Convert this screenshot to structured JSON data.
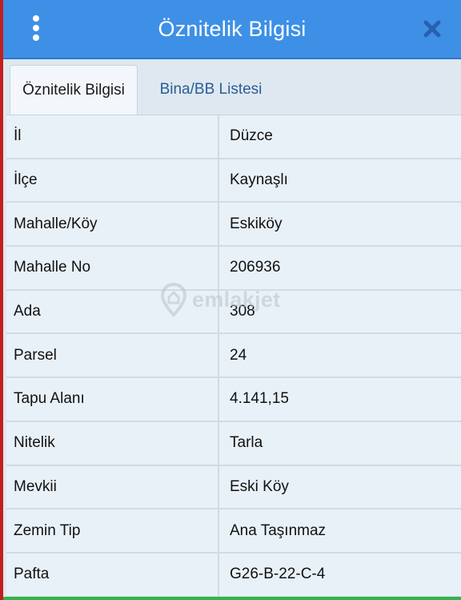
{
  "header": {
    "title": "Öznitelik Bilgisi",
    "menu_icon": "vertical-dots-icon",
    "close_icon": "close-icon"
  },
  "tabs": [
    {
      "label": "Öznitelik Bilgisi",
      "active": true
    },
    {
      "label": "Bina/BB Listesi",
      "active": false
    }
  ],
  "rows": [
    {
      "label": "İl",
      "value": "Düzce"
    },
    {
      "label": "İlçe",
      "value": "Kaynaşlı"
    },
    {
      "label": "Mahalle/Köy",
      "value": "Eskiköy"
    },
    {
      "label": "Mahalle No",
      "value": "206936"
    },
    {
      "label": "Ada",
      "value": "308"
    },
    {
      "label": "Parsel",
      "value": "24"
    },
    {
      "label": "Tapu Alanı",
      "value": "4.141,15"
    },
    {
      "label": "Nitelik",
      "value": "Tarla"
    },
    {
      "label": "Mevkii",
      "value": "Eski Köy"
    },
    {
      "label": "Zemin Tip",
      "value": "Ana Taşınmaz"
    },
    {
      "label": "Pafta",
      "value": "G26-B-22-C-4"
    }
  ],
  "watermark": {
    "text": "emlakjet"
  },
  "colors": {
    "header_bg": "#3d90e6",
    "panel_bg": "#dfe8f0",
    "cell_bg": "#e9f1f8",
    "tab_inactive_text": "#2a5d96",
    "bottom_bar": "#33b34a"
  }
}
